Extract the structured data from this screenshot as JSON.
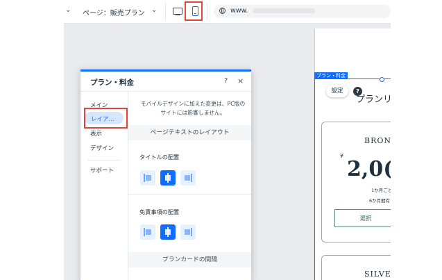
{
  "topbar": {
    "left_chevron": "⌄",
    "page_selector": "ページ：販売プラン",
    "page_caret": "⌄",
    "url": "www."
  },
  "preview": {
    "selection_tag": "プラン・料金",
    "settings_button": "設定",
    "help_button": "?",
    "plan_list_title": "プランリ",
    "plans": [
      {
        "tier": "BRONZ",
        "currency": "¥",
        "price": "2,0(",
        "cycle": "1か月ごと",
        "duration": "6か月間有",
        "button": "選択"
      },
      {
        "tier": "SILVE"
      }
    ]
  },
  "panel": {
    "title": "プラン・料金",
    "help": "?",
    "close": "×",
    "nav": {
      "main": "メイン",
      "layout": "レイア…",
      "display": "表示",
      "design": "デザイン",
      "support": "サポート"
    },
    "notice": "モバイルデザインに加えた変更は、PC版のサイトには影響しません。",
    "section_page_text": "ページテキストのレイアウト",
    "title_alignment_label": "タイトルの配置",
    "disclaimer_alignment_label": "免責事項の配置",
    "section_card_spacing": "プランカードの間隔",
    "title_alignment_selected": "center",
    "disclaimer_alignment_selected": "center"
  },
  "colors": {
    "accent": "#116dff",
    "highlight": "#e0453a",
    "canvas": "#e9ebee"
  }
}
